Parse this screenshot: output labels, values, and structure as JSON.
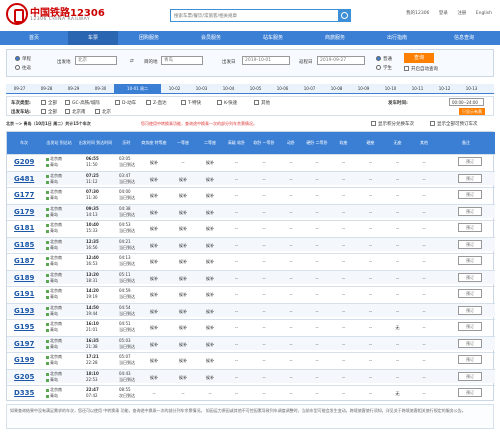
{
  "header": {
    "brand": "中国铁路12306",
    "brand_en": "12306 CHINA RAILWAY",
    "search_placeholder": "搜索车票/餐饮/常旅客/相关规章",
    "links": [
      "我的12306",
      "登录",
      "注册",
      "English"
    ]
  },
  "nav": [
    "首页",
    "车票",
    "团购服务",
    "会员服务",
    "站车服务",
    "商旅服务",
    "出行指南",
    "信息查询"
  ],
  "query": {
    "trip_types": [
      "单程",
      "往返"
    ],
    "from_label": "出发地",
    "from_value": "北京",
    "to_label": "目的地",
    "to_value": "青岛",
    "date_label": "出发日",
    "date_value": "2019-10-01",
    "return_label": "返程日",
    "return_value": "2019-09-27",
    "ticket_types": [
      "普通",
      "学生"
    ],
    "query_button": "查询",
    "auto_query": "开启自动查询"
  },
  "dates": [
    "09-27",
    "09-28",
    "09-29",
    "09-30",
    "10-01 周二",
    "10-02",
    "10-03",
    "10-04",
    "10-05",
    "10-06",
    "10-07",
    "10-08",
    "10-09",
    "10-10",
    "10-11",
    "10-12",
    "10-13",
    "10-14",
    "10-15",
    "10-16"
  ],
  "filters": {
    "type_label": "车次类型:",
    "types": [
      "全部",
      "GC-高铁/城际",
      "D-动车",
      "Z-直达",
      "T-特快",
      "K-快速",
      "其他"
    ],
    "station_label": "出发车站:",
    "stations": [
      "全部",
      "北京南",
      "北京"
    ],
    "arrive_label": "到达车站:",
    "arrive_stations": [
      "全部",
      "青岛"
    ],
    "time_label": "发车时间:",
    "time_value": "00:00--24:00",
    "show_all": "只显示有票"
  },
  "route": {
    "title": "北京 --> 青岛（10月1日 周二）共计15个车次",
    "notice": "您可使用中转换乘功能，查询途中换乘一次的部分列车余票情况。",
    "check1": "显示积分兑换车次",
    "check2": "显示全部可预订车次"
  },
  "table_headers": [
    "车次",
    "出发站\n到达站",
    "出发时间\n到达时间",
    "历时",
    "商务座\n特等座",
    "一等座",
    "二等座",
    "高级\n软卧",
    "软卧\n一等卧",
    "动卧",
    "硬卧\n二等卧",
    "软座",
    "硬座",
    "无座",
    "其他",
    "备注"
  ],
  "trains": [
    {
      "code": "G209",
      "from": "北京南",
      "to": "青岛",
      "dep": "06:55",
      "arr": "11:50",
      "dur": "03:05",
      "dur2": "当日到达",
      "seats": [
        "候补",
        "--",
        "候补",
        "--",
        "--",
        "--",
        "--",
        "--",
        "--",
        "--",
        "--"
      ]
    },
    {
      "code": "G481",
      "from": "北京南",
      "to": "青岛",
      "dep": "07:25",
      "arr": "11:12",
      "dur": "03:47",
      "dur2": "当日到达",
      "seats": [
        "候补",
        "候补",
        "候补",
        "--",
        "--",
        "--",
        "--",
        "--",
        "--",
        "--",
        "--"
      ]
    },
    {
      "code": "G177",
      "from": "北京南",
      "to": "青岛",
      "dep": "07:30",
      "arr": "11:30",
      "dur": "04:00",
      "dur2": "当日到达",
      "seats": [
        "候补",
        "候补",
        "候补",
        "--",
        "--",
        "--",
        "--",
        "--",
        "--",
        "--",
        "--"
      ]
    },
    {
      "code": "G179",
      "from": "北京南",
      "to": "青岛",
      "dep": "09:35",
      "arr": "14:13",
      "dur": "04:38",
      "dur2": "当日到达",
      "seats": [
        "候补",
        "候补",
        "候补",
        "--",
        "--",
        "--",
        "--",
        "--",
        "--",
        "--",
        "--"
      ]
    },
    {
      "code": "G181",
      "from": "北京南",
      "to": "青岛",
      "dep": "10:40",
      "arr": "15:33",
      "dur": "04:53",
      "dur2": "当日到达",
      "seats": [
        "候补",
        "候补",
        "候补",
        "--",
        "--",
        "--",
        "--",
        "--",
        "--",
        "--",
        "--"
      ]
    },
    {
      "code": "G185",
      "from": "北京南",
      "to": "青岛",
      "dep": "12:35",
      "arr": "16:56",
      "dur": "04:21",
      "dur2": "当日到达",
      "seats": [
        "候补",
        "候补",
        "候补",
        "--",
        "--",
        "--",
        "--",
        "--",
        "--",
        "--",
        "--"
      ]
    },
    {
      "code": "G187",
      "from": "北京南",
      "to": "青岛",
      "dep": "12:40",
      "arr": "16:53",
      "dur": "04:13",
      "dur2": "当日到达",
      "seats": [
        "候补",
        "候补",
        "候补",
        "--",
        "--",
        "--",
        "--",
        "--",
        "--",
        "--",
        "--"
      ]
    },
    {
      "code": "G189",
      "from": "北京南",
      "to": "青岛",
      "dep": "13:20",
      "arr": "18:31",
      "dur": "05:11",
      "dur2": "当日到达",
      "seats": [
        "候补",
        "候补",
        "候补",
        "--",
        "--",
        "--",
        "--",
        "--",
        "--",
        "--",
        "--"
      ]
    },
    {
      "code": "G191",
      "from": "北京南",
      "to": "青岛",
      "dep": "14:20",
      "arr": "19:19",
      "dur": "04:59",
      "dur2": "当日到达",
      "seats": [
        "候补",
        "候补",
        "候补",
        "--",
        "--",
        "--",
        "--",
        "--",
        "--",
        "--",
        "--"
      ]
    },
    {
      "code": "G193",
      "from": "北京南",
      "to": "青岛",
      "dep": "14:50",
      "arr": "19:44",
      "dur": "04:54",
      "dur2": "当日到达",
      "seats": [
        "候补",
        "候补",
        "候补",
        "--",
        "--",
        "--",
        "--",
        "--",
        "--",
        "--",
        "--"
      ]
    },
    {
      "code": "G195",
      "from": "北京南",
      "to": "青岛",
      "dep": "16:10",
      "arr": "21:01",
      "dur": "04:51",
      "dur2": "当日到达",
      "seats": [
        "候补",
        "候补",
        "候补",
        "--",
        "--",
        "--",
        "--",
        "--",
        "--",
        "无",
        "--"
      ]
    },
    {
      "code": "G197",
      "from": "北京南",
      "to": "青岛",
      "dep": "16:35",
      "arr": "21:38",
      "dur": "05:03",
      "dur2": "当日到达",
      "seats": [
        "候补",
        "候补",
        "候补",
        "--",
        "--",
        "--",
        "--",
        "--",
        "--",
        "--",
        "--"
      ]
    },
    {
      "code": "G199",
      "from": "北京南",
      "to": "青岛",
      "dep": "17:21",
      "arr": "22:28",
      "dur": "05:07",
      "dur2": "当日到达",
      "seats": [
        "候补",
        "候补",
        "候补",
        "--",
        "--",
        "--",
        "--",
        "--",
        "--",
        "--",
        "--"
      ]
    },
    {
      "code": "G205",
      "from": "北京南",
      "to": "青岛",
      "dep": "18:10",
      "arr": "22:53",
      "dur": "04:43",
      "dur2": "当日到达",
      "seats": [
        "候补",
        "候补",
        "候补",
        "--",
        "--",
        "--",
        "--",
        "--",
        "--",
        "--",
        "--"
      ]
    },
    {
      "code": "D335",
      "from": "北京南",
      "to": "青岛",
      "dep": "22:47",
      "arr": "07:42",
      "dur": "08:55",
      "dur2": "次日到达",
      "seats": [
        "--",
        "--",
        "--",
        "--",
        "--",
        "--",
        "--",
        "--",
        "--",
        "无",
        "--"
      ]
    }
  ],
  "order_label": "预订",
  "footer": "如果查询结果中没有满足需求的车次，您还可以使用 中转换乘 功能，查询途中换乘一次的部分列车余票情况。\n如因运力原因或其他不可控因素导致列车调度调整时，当前车型可能会发生变动。跨境旅客旅行须知，详见关于跨境旅客相关旅行规定的服务公告。"
}
